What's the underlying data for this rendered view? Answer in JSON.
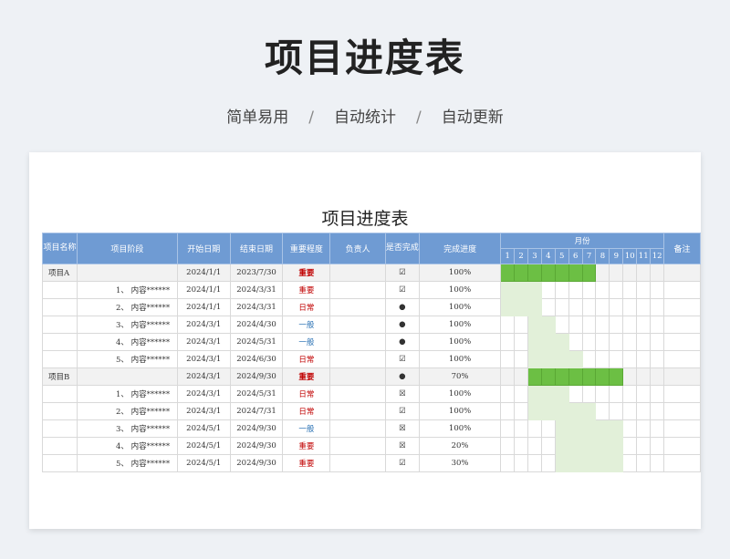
{
  "hero": {
    "title": "项目进度表",
    "subtitle_parts": [
      "简单易用",
      "自动统计",
      "自动更新"
    ],
    "separator": "/"
  },
  "sheet": {
    "title": "项目进度表",
    "headers": {
      "name": "项目名称",
      "stage": "项目阶段",
      "start": "开始日期",
      "end": "结束日期",
      "importance": "重要程度",
      "owner": "负责人",
      "done": "是否完成",
      "progress": "完成进度",
      "month": "月份",
      "note": "备注"
    },
    "months": [
      "1",
      "2",
      "3",
      "4",
      "5",
      "6",
      "7",
      "8",
      "9",
      "10",
      "11",
      "12"
    ],
    "rows": [
      {
        "kind": "proj",
        "name": "项目A",
        "stage": "",
        "start": "2024/1/1",
        "end": "2023/7/30",
        "importance": "重要",
        "owner": "",
        "done": "☑",
        "progress": "100%",
        "from": 1,
        "to": 7
      },
      {
        "kind": "task",
        "name": "",
        "stage": "1、 内容******",
        "start": "2024/1/1",
        "end": "2024/3/31",
        "importance": "重要",
        "owner": "",
        "done": "☑",
        "progress": "100%",
        "from": 1,
        "to": 3
      },
      {
        "kind": "task",
        "name": "",
        "stage": "2、 内容******",
        "start": "2024/1/1",
        "end": "2024/3/31",
        "importance": "日常",
        "owner": "",
        "done": "●",
        "progress": "100%",
        "from": 1,
        "to": 3
      },
      {
        "kind": "task",
        "name": "",
        "stage": "3、 内容******",
        "start": "2024/3/1",
        "end": "2024/4/30",
        "importance": "一般",
        "owner": "",
        "done": "●",
        "progress": "100%",
        "from": 3,
        "to": 4
      },
      {
        "kind": "task",
        "name": "",
        "stage": "4、 内容******",
        "start": "2024/3/1",
        "end": "2024/5/31",
        "importance": "一般",
        "owner": "",
        "done": "●",
        "progress": "100%",
        "from": 3,
        "to": 5
      },
      {
        "kind": "task",
        "name": "",
        "stage": "5、 内容******",
        "start": "2024/3/1",
        "end": "2024/6/30",
        "importance": "日常",
        "owner": "",
        "done": "☑",
        "progress": "100%",
        "from": 3,
        "to": 6
      },
      {
        "kind": "proj",
        "name": "项目B",
        "stage": "",
        "start": "2024/3/1",
        "end": "2024/9/30",
        "importance": "重要",
        "owner": "",
        "done": "●",
        "progress": "70%",
        "from": 3,
        "to": 9
      },
      {
        "kind": "task",
        "name": "",
        "stage": "1、 内容******",
        "start": "2024/3/1",
        "end": "2024/5/31",
        "importance": "日常",
        "owner": "",
        "done": "☒",
        "progress": "100%",
        "from": 3,
        "to": 5
      },
      {
        "kind": "task",
        "name": "",
        "stage": "2、 内容******",
        "start": "2024/3/1",
        "end": "2024/7/31",
        "importance": "日常",
        "owner": "",
        "done": "☑",
        "progress": "100%",
        "from": 3,
        "to": 7
      },
      {
        "kind": "task",
        "name": "",
        "stage": "3、 内容******",
        "start": "2024/5/1",
        "end": "2024/9/30",
        "importance": "一般",
        "owner": "",
        "done": "☒",
        "progress": "100%",
        "from": 5,
        "to": 9
      },
      {
        "kind": "task",
        "name": "",
        "stage": "4、 内容******",
        "start": "2024/5/1",
        "end": "2024/9/30",
        "importance": "重要",
        "owner": "",
        "done": "☒",
        "progress": "20%",
        "from": 5,
        "to": 9
      },
      {
        "kind": "task",
        "name": "",
        "stage": "5、 内容******",
        "start": "2024/5/1",
        "end": "2024/9/30",
        "importance": "重要",
        "owner": "",
        "done": "☑",
        "progress": "30%",
        "from": 5,
        "to": 9
      }
    ]
  }
}
